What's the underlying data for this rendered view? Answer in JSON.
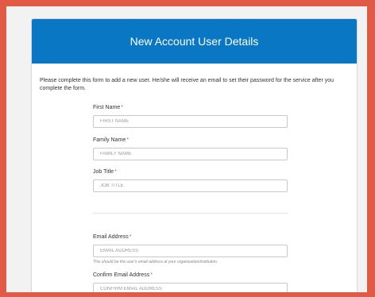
{
  "form": {
    "title": "New Account User Details",
    "intro": "Please complete this form to add a new user. He/she will receive an email to set their password for the service after you complete the form.",
    "required_marker": "*",
    "fields": [
      {
        "label": "First Name",
        "placeholder": "FIRST NAME",
        "value": ""
      },
      {
        "label": "Family Name",
        "placeholder": "FAMILY NAME",
        "value": ""
      },
      {
        "label": "Job Title",
        "placeholder": "JOB TITLE",
        "value": ""
      },
      {
        "label": "Email Address",
        "placeholder": "EMAIL ADDRESS",
        "value": "",
        "hint": "This should be the user's email address at your organisation/institution."
      },
      {
        "label": "Confirm Email Address",
        "placeholder": "CONFIRM EMAIL ADDRESS",
        "value": ""
      }
    ]
  },
  "colors": {
    "background_border": "#e05a45",
    "header": "#0a77c4",
    "required": "#e05a45"
  }
}
